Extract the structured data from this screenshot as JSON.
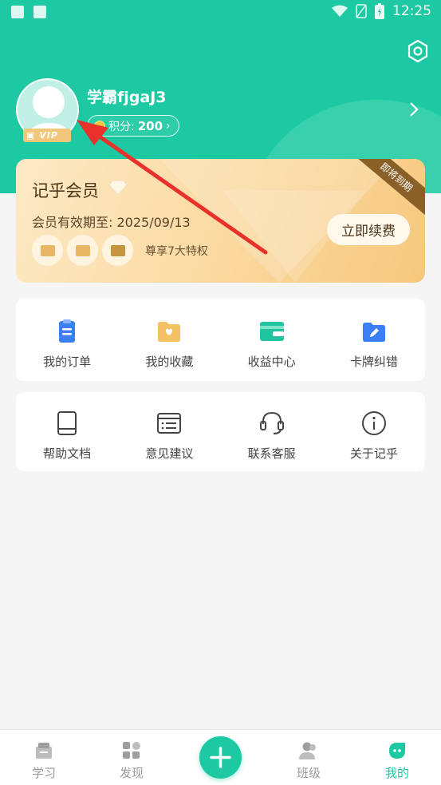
{
  "status_bar": {
    "time": "12:25"
  },
  "profile": {
    "username": "学霸fjgaJ3",
    "points_label": "积分:",
    "points_value": "200",
    "vip_badge": "VIP"
  },
  "vip_card": {
    "title": "记乎会员",
    "expiry": "会员有效期至: 2025/09/13",
    "privileges_text": "尊享7大特权",
    "renew_label": "立即续费",
    "ribbon": "即将到期"
  },
  "menu_primary": [
    {
      "label": "我的订单",
      "icon": "order-icon"
    },
    {
      "label": "我的收藏",
      "icon": "favorites-icon"
    },
    {
      "label": "收益中心",
      "icon": "earnings-icon"
    },
    {
      "label": "卡牌纠错",
      "icon": "card-correction-icon"
    }
  ],
  "menu_secondary": [
    {
      "label": "帮助文档",
      "icon": "book-icon"
    },
    {
      "label": "意见建议",
      "icon": "feedback-icon"
    },
    {
      "label": "联系客服",
      "icon": "headset-icon"
    },
    {
      "label": "关于记乎",
      "icon": "info-icon"
    }
  ],
  "tabbar": [
    {
      "label": "学习",
      "icon": "study-icon",
      "active": false
    },
    {
      "label": "发现",
      "icon": "discover-icon",
      "active": false
    },
    {
      "label": "",
      "icon": "add-icon",
      "active": false
    },
    {
      "label": "班级",
      "icon": "class-icon",
      "active": false
    },
    {
      "label": "我的",
      "icon": "me-icon",
      "active": true
    }
  ],
  "colors": {
    "brand": "#1cc9a3",
    "vip_gold": "#f6c87d",
    "annotation_arrow": "#e8312a"
  }
}
